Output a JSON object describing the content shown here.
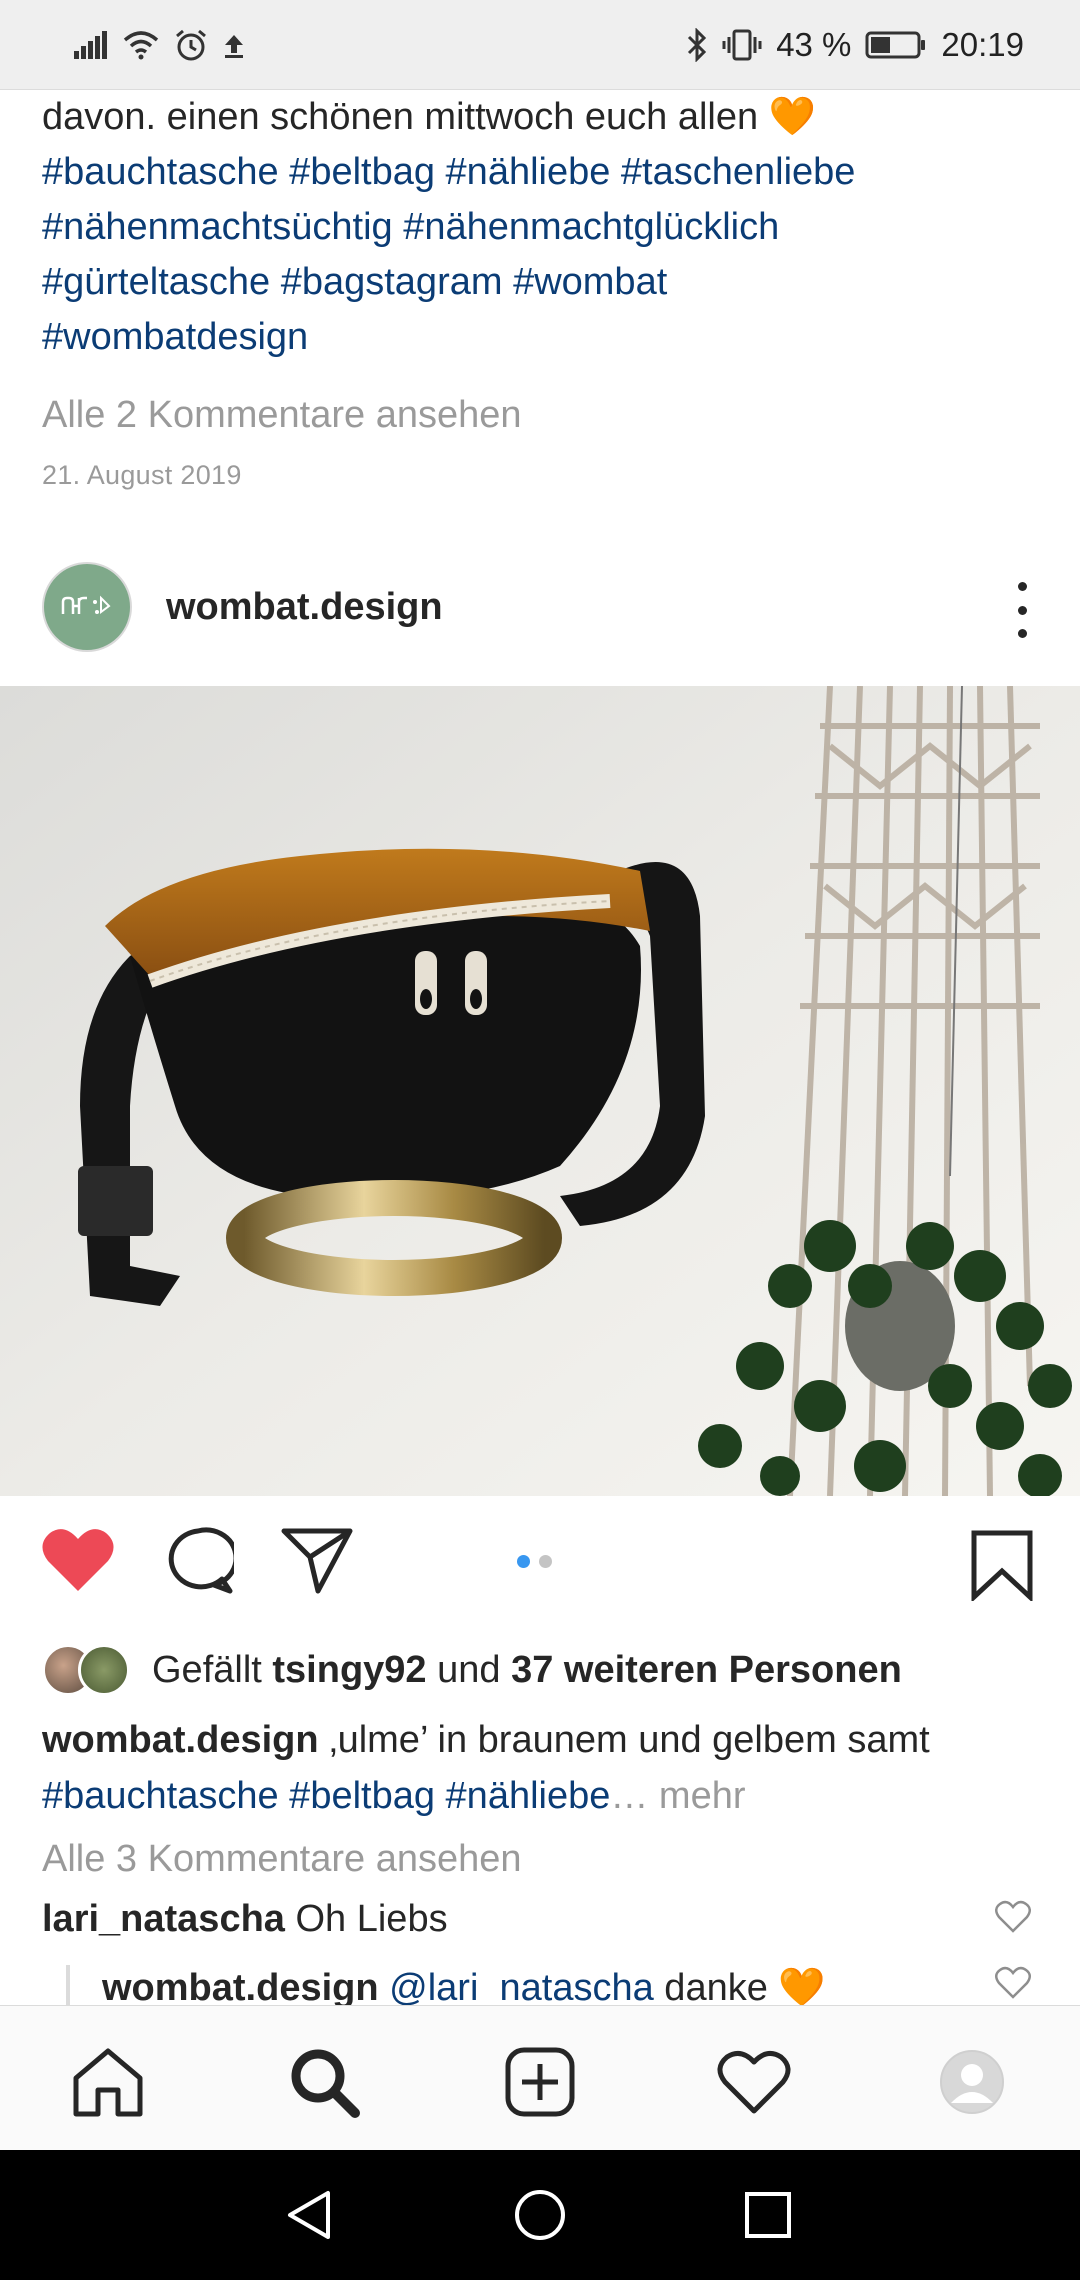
{
  "status_bar": {
    "battery_percent_text": "43 %",
    "time": "20:19",
    "battery_level": 0.43,
    "icons": [
      "signal-icon",
      "wifi-icon",
      "alarm-icon",
      "upload-icon",
      "bluetooth-icon",
      "vibrate-icon",
      "battery-icon"
    ]
  },
  "previous_post": {
    "caption_line_1": "davon. einen schönen mittwoch euch allen 🧡",
    "hashtag_lines": [
      "#bauchtasche #beltbag #nähliebe #taschenliebe",
      "#nähenmachtsüchtig #nähenmachtglücklich",
      "#gürteltasche #bagstagram #wombat",
      "#wombatdesign"
    ],
    "view_comments": "Alle 2 Kommentare ansehen",
    "date": "21. August 2019"
  },
  "post": {
    "username": "wombat.design",
    "avatar_bg": "#7fa98a",
    "carousel": {
      "count": 2,
      "active": 1,
      "active_color": "#3897f0"
    },
    "liked": true,
    "like_color": "#ed4956",
    "likes": {
      "prefix": "Gefällt ",
      "user": "tsingy92",
      "middle": " und ",
      "others": "37 weiteren Personen"
    },
    "caption": {
      "username": "wombat.design",
      "text": " ‚ulme’ in braunem und gelbem samt",
      "hashtags": "#bauchtasche #beltbag #nähliebe",
      "ellipsis": "…",
      "more": " mehr"
    },
    "view_comments": "Alle 3 Kommentare ansehen",
    "comments": [
      {
        "username": "lari_natascha",
        "text": " Oh Liebs"
      },
      {
        "username": "wombat.design",
        "mention": " @lari_natascha",
        "text": " danke 🧡"
      }
    ]
  },
  "bottom_nav": [
    "home-icon",
    "search-icon",
    "add-post-icon",
    "activity-heart-icon",
    "profile-icon"
  ],
  "system_nav": [
    "back-icon",
    "home-circle-icon",
    "recents-icon"
  ]
}
